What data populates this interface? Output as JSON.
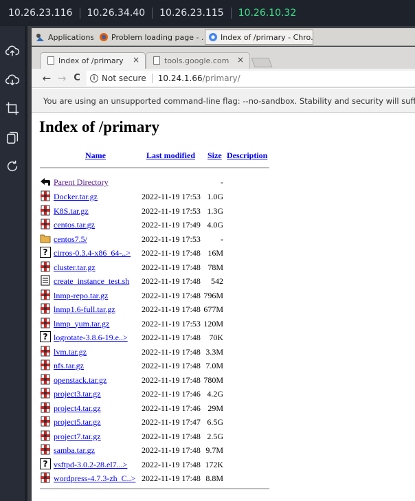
{
  "ip_bar": {
    "hosts": [
      "10.26.23.116",
      "10.26.34.40",
      "10.26.23.115",
      "10.26.10.32"
    ],
    "active_index": 3
  },
  "sidebar": {
    "buttons": [
      "cloud-upload-icon",
      "cloud-download-icon",
      "crop-icon",
      "copy-icon",
      "refresh-icon"
    ]
  },
  "taskbar": {
    "items": [
      {
        "label": "Applications",
        "icon": "applications-icon"
      },
      {
        "label": "Problem loading page - ...",
        "icon": "firefox-icon"
      },
      {
        "label": "Index of /primary - Chro...",
        "icon": "chrome-icon"
      }
    ]
  },
  "browser": {
    "tabs": [
      {
        "label": "Index of /primary",
        "close": "×"
      },
      {
        "label": "tools.google.com",
        "close": "×"
      }
    ],
    "nav": {
      "back": "←",
      "forward": "→",
      "reload": "C"
    },
    "omnibox": {
      "security_icon": "i",
      "security_label": "Not secure",
      "url_host": "10.24.1.66",
      "url_path": "/primary/"
    },
    "infobar": "You are using an unsupported command-line flag: --no-sandbox. Stability and security will suffer."
  },
  "page": {
    "title": "Index of /primary",
    "headers": {
      "name": "Name",
      "modified": "Last modified",
      "size": "Size",
      "description": "Description"
    },
    "parent": {
      "name": "Parent Directory",
      "date": "",
      "size": "-"
    },
    "files": [
      {
        "name": "Docker.tar.gz",
        "date": "2022-11-19 17:53",
        "size": "1.0G",
        "icon": "tar-icon"
      },
      {
        "name": "K8S.tar.gz",
        "date": "2022-11-19 17:53",
        "size": "1.3G",
        "icon": "tar-icon"
      },
      {
        "name": "centos.tar.gz",
        "date": "2022-11-19 17:49",
        "size": "4.0G",
        "icon": "tar-icon"
      },
      {
        "name": "centos7.5/",
        "date": "2022-11-19 17:53",
        "size": "-",
        "icon": "folder-icon"
      },
      {
        "name": "cirros-0.3.4-x86_64-..>",
        "date": "2022-11-19 17:48",
        "size": "16M",
        "icon": "unknown-icon"
      },
      {
        "name": "cluster.tar.gz",
        "date": "2022-11-19 17:48",
        "size": "78M",
        "icon": "tar-icon"
      },
      {
        "name": "create_instance_test.sh",
        "date": "2022-11-19 17:48",
        "size": "542",
        "icon": "text-icon"
      },
      {
        "name": "lnmp-repo.tar.gz",
        "date": "2022-11-19 17:48",
        "size": "796M",
        "icon": "tar-icon"
      },
      {
        "name": "lnmp1.6-full.tar.gz",
        "date": "2022-11-19 17:48",
        "size": "677M",
        "icon": "tar-icon"
      },
      {
        "name": "lnmp_yum.tar.gz",
        "date": "2022-11-19 17:53",
        "size": "120M",
        "icon": "tar-icon"
      },
      {
        "name": "logrotate-3.8.6-19.e..>",
        "date": "2022-11-19 17:48",
        "size": "70K",
        "icon": "unknown-icon"
      },
      {
        "name": "lvm.tar.gz",
        "date": "2022-11-19 17:48",
        "size": "3.3M",
        "icon": "tar-icon"
      },
      {
        "name": "nfs.tar.gz",
        "date": "2022-11-19 17:48",
        "size": "7.0M",
        "icon": "tar-icon"
      },
      {
        "name": "openstack.tar.gz",
        "date": "2022-11-19 17:48",
        "size": "780M",
        "icon": "tar-icon"
      },
      {
        "name": "project3.tar.gz",
        "date": "2022-11-19 17:46",
        "size": "4.2G",
        "icon": "tar-icon"
      },
      {
        "name": "project4.tar.gz",
        "date": "2022-11-19 17:46",
        "size": "29M",
        "icon": "tar-icon"
      },
      {
        "name": "project5.tar.gz",
        "date": "2022-11-19 17:47",
        "size": "6.5G",
        "icon": "tar-icon"
      },
      {
        "name": "project7.tar.gz",
        "date": "2022-11-19 17:48",
        "size": "2.5G",
        "icon": "tar-icon"
      },
      {
        "name": "samba.tar.gz",
        "date": "2022-11-19 17:48",
        "size": "9.7M",
        "icon": "tar-icon"
      },
      {
        "name": "vsftpd-3.0.2-28.el7...>",
        "date": "2022-11-19 17:48",
        "size": "172K",
        "icon": "unknown-icon"
      },
      {
        "name": "wordpress-4.7.3-zh_C..>",
        "date": "2022-11-19 17:48",
        "size": "8.8M",
        "icon": "tar-icon"
      }
    ]
  },
  "colors": {
    "active_ip": "#3ee08a",
    "link": "#0000ee",
    "visited": "#551a8b"
  }
}
